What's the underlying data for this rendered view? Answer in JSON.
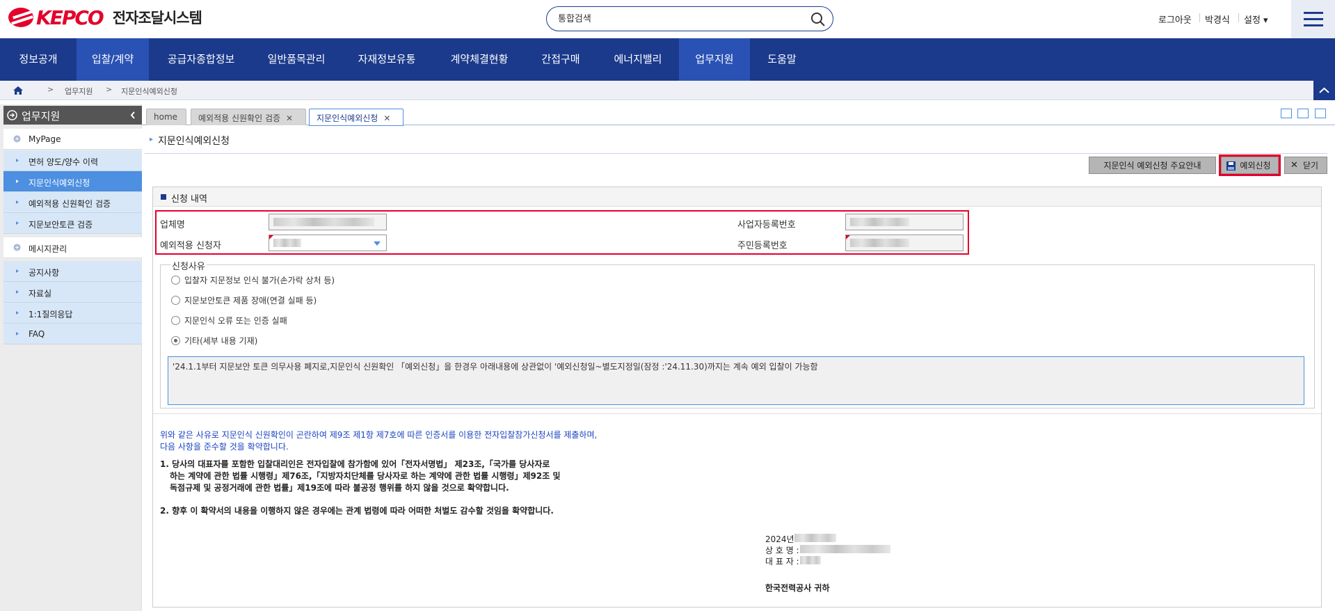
{
  "header": {
    "logo_text": "KEPCO",
    "system_name": "전자조달시스템",
    "search_placeholder": "통합검색",
    "logout": "로그아웃",
    "user_name": "박경식",
    "settings": "설정 ▾"
  },
  "nav": {
    "items": [
      "정보공개",
      "입찰/계약",
      "공급자종합정보",
      "일반품목관리",
      "자재정보유통",
      "계약체결현황",
      "간접구매",
      "에너지밸리",
      "업무지원",
      "도움말"
    ],
    "active": [
      "입찰/계약",
      "업무지원"
    ]
  },
  "breadcrumb": [
    "업무지원",
    "지문인식예외신청"
  ],
  "sidebar": {
    "title": "업무지원",
    "items": [
      {
        "label": "MyPage",
        "type": "group"
      },
      {
        "label": "면허 양도/양수 이력",
        "type": "sub"
      },
      {
        "label": "지문인식예외신청",
        "type": "sub",
        "active": true
      },
      {
        "label": "예외적용 신원확인 검증",
        "type": "sub"
      },
      {
        "label": "지문보안토큰 검증",
        "type": "sub"
      },
      {
        "label": "메시지관리",
        "type": "group"
      },
      {
        "label": "공지사항",
        "type": "sub"
      },
      {
        "label": "자료실",
        "type": "sub"
      },
      {
        "label": "1:1질의응답",
        "type": "sub"
      },
      {
        "label": "FAQ",
        "type": "sub"
      }
    ]
  },
  "tabs": [
    {
      "label": "home",
      "closable": false
    },
    {
      "label": "예외적용 신원확인 검증",
      "closable": true
    },
    {
      "label": "지문인식예외신청",
      "closable": true,
      "active": true
    }
  ],
  "page": {
    "title": "지문인식예외신청",
    "buttons": {
      "guide": "지문인식 예외신청 주요안내",
      "apply": "예외신청",
      "close": "닫기"
    }
  },
  "form": {
    "section_title": "신청 내역",
    "company_label": "업체명",
    "applicant_label": "예외적용 신청자",
    "bizno_label": "사업자등록번호",
    "residentno_label": "주민등록번호"
  },
  "reason": {
    "legend": "신청사유",
    "options": [
      {
        "label": "입찰자 지문정보 인식 불가(손가락 상처 등)",
        "checked": false
      },
      {
        "label": "지문보안토큰 제품 장애(연결 실패 등)",
        "checked": false
      },
      {
        "label": "지문인식 오류 또는 인증 실패",
        "checked": false
      },
      {
        "label": "기타(세부 내용 기재)",
        "checked": true
      }
    ],
    "text": "'24.1.1부터 지문보안 토큰 의무사용 폐지로,지문인식 신원확인 「예외신청」을 한경우 아래내용에 상관없이 '예외신청일~별도지정일(잠정 :'24.11.30)까지는 계속 예외 입찰이 가능함"
  },
  "notice": {
    "blue_line1": "위와 같은 사유로 지문인식 신원확인이 곤란하여 제9조 제1항 제7호에 따른 인증서를 이용한 전자입찰참가신청서를 제출하며,",
    "blue_line2": "다음 사항을 준수할 것을 확약합니다.",
    "item1_line1": "1. 당사의 대표자를 포함한 입찰대리인은 전자입찰에 참가함에 있어「전자서명법」 제23조,「국가를 당사자로",
    "item1_line2": "   하는 계약에 관한 법률 시행령」제76조,「지방자치단체를 당사자로 하는 계약에 관한 법률 시행령」제92조 및",
    "item1_line3": "   독점규제 및 공정거래에 관한 법률」제19조에 따라 불공정 행위를 하지 않을 것으로 확약합니다.",
    "item2": "2. 향후 이 확약서의 내용을 이행하지 않은 경우에는 관계 법령에 따라 어떠한 처벌도 감수할 것임을 확약합니다."
  },
  "sign": {
    "year": "2024년",
    "company": "상 호 명 :",
    "ceo": "대 표 자 :",
    "addressee": "한국전력공사 귀하"
  },
  "colors": {
    "brand_red": "#e4002b",
    "nav_blue": "#1b3a8c",
    "active_blue": "#4d8fe0"
  }
}
